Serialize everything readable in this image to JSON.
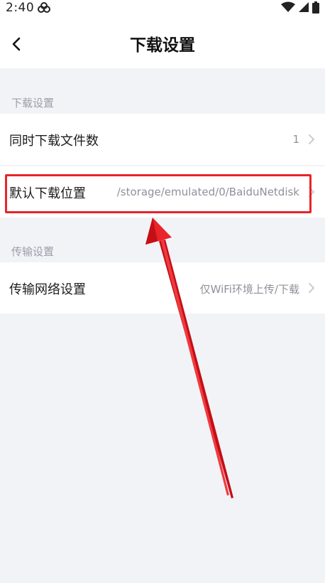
{
  "status_bar": {
    "time": "2:40",
    "app_icon": "cloud-logo-icon",
    "right_icons": [
      "wifi-icon",
      "cellular-signal-icon",
      "battery-icon"
    ]
  },
  "header": {
    "title": "下载设置",
    "back_icon": "chevron-left-icon"
  },
  "sections": [
    {
      "label": "下载设置",
      "rows": [
        {
          "label": "同时下载文件数",
          "value": "1"
        },
        {
          "label": "默认下载位置",
          "value": "/storage/emulated/0/BaiduNetdisk"
        }
      ]
    },
    {
      "label": "传输设置",
      "rows": [
        {
          "label": "传输网络设置",
          "value": "仅WiFi环境上传/下载"
        }
      ]
    }
  ],
  "annotation": {
    "highlight_color": "#e8242a",
    "arrow_color": "#e8242a"
  }
}
